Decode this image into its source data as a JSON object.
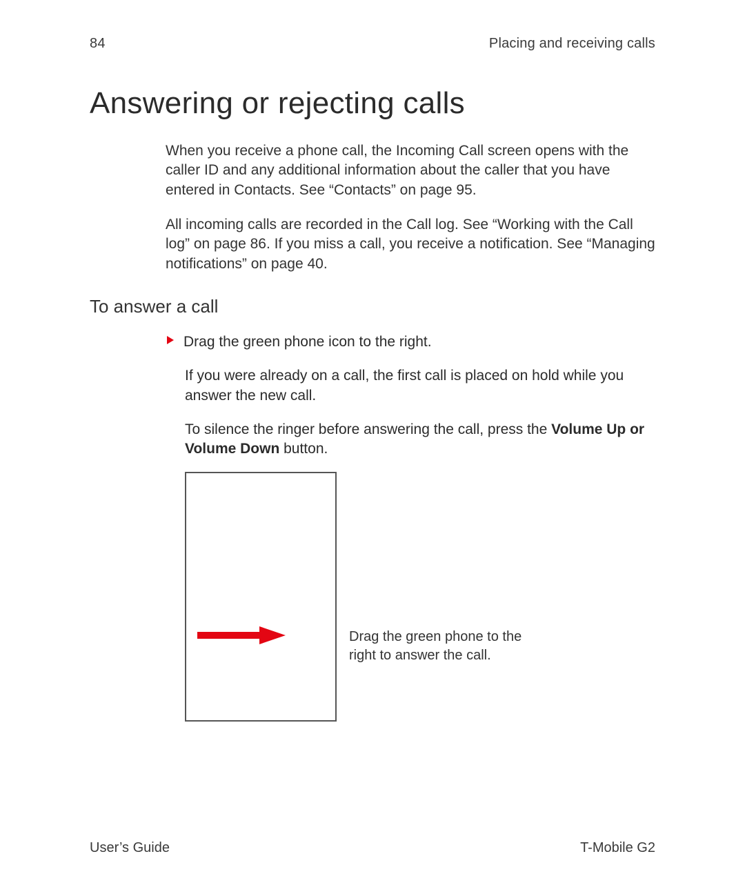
{
  "header": {
    "page_number": "84",
    "section": "Placing and receiving calls"
  },
  "title": "Answering or rejecting calls",
  "intro": {
    "p1": "When you receive a phone call, the Incoming Call screen opens with the caller ID and any additional information about the caller that you have entered in Contacts. See “Contacts” on page 95.",
    "p2": "All incoming calls are recorded in the Call log. See “Working with the Call log” on page 86. If you miss a call, you receive a notification. See “Managing notifications” on page 40."
  },
  "subhead": "To answer a call",
  "step": {
    "text": "Drag the green phone icon to the right."
  },
  "follow1": "If you were already on a call, the first call is placed on hold while you answer the new call.",
  "follow2_pre": "To silence the ringer before answering the call, press the ",
  "follow2_bold": "Volume Up or Volume Down",
  "follow2_post": " button.",
  "figure": {
    "caption": "Drag the green phone to the right to answer the call."
  },
  "footer": {
    "left": "User’s Guide",
    "right": "T-Mobile G2"
  },
  "colors": {
    "accent_red": "#e30613"
  }
}
